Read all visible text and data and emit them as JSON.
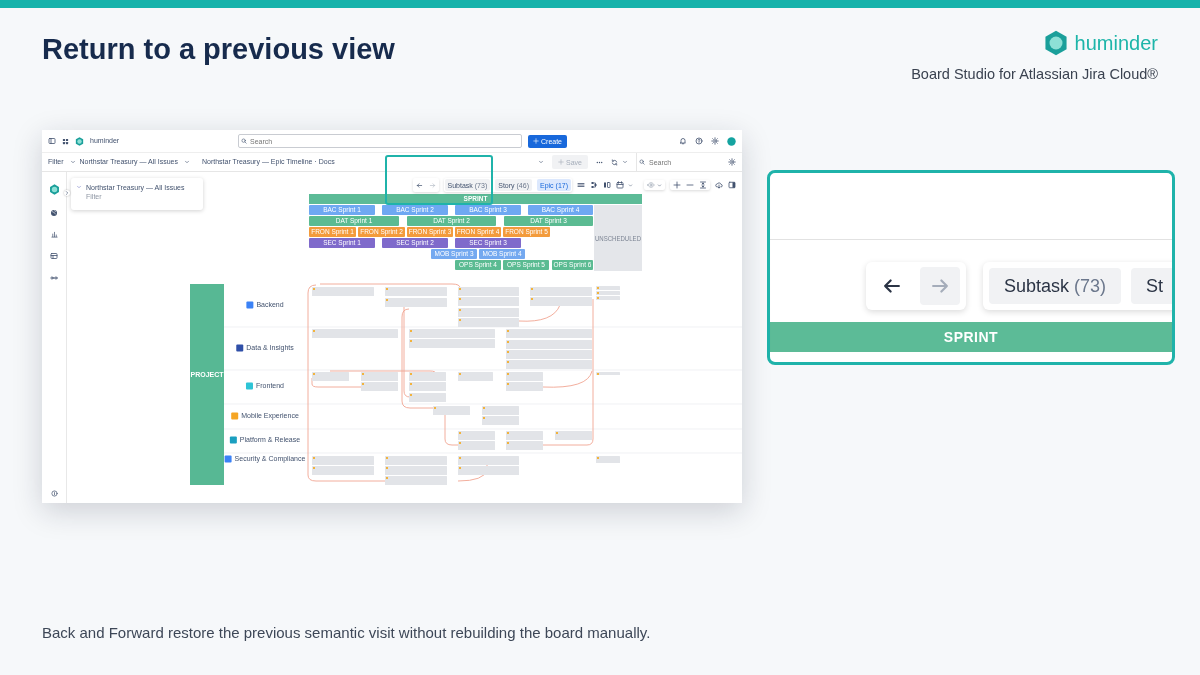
{
  "slide": {
    "title": "Return to a previous view",
    "brand": "huminder",
    "subtitle": "Board Studio for Atlassian Jira Cloud®",
    "caption": "Back and Forward restore the previous semantic visit without rebuilding the board manually."
  },
  "app": {
    "app_name": "huminder",
    "search": {
      "placeholder": "Search"
    },
    "create_label": "Create",
    "filter_bar": {
      "label": "Filter",
      "view": "Northstar Treasury — All Issues",
      "board": "Northstar Treasury — Epic Timeline · Docs",
      "save_label": "Save",
      "save_disabled": true,
      "search": {
        "placeholder": "Search"
      }
    },
    "filter_card": {
      "title": "Northstar Treasury — All Issues",
      "subtitle": "Filter"
    },
    "history": [
      {
        "kind": "back",
        "disabled": false
      },
      {
        "kind": "forward",
        "disabled": true
      }
    ],
    "type_chips": [
      {
        "label": "Subtask",
        "count": "(73)",
        "selected": false
      },
      {
        "label": "Story",
        "count": "(46)",
        "selected": false
      },
      {
        "label": "Epic",
        "count": "(17)",
        "selected": true
      }
    ],
    "timeline": {
      "header": "SPRINT",
      "unscheduled": "UNSCHEDULED",
      "rows": [
        {
          "sprints": [
            {
              "label": "BAC Sprint 1",
              "color": "#6ea8f2"
            },
            {
              "label": "BAC Sprint 2",
              "color": "#6ea8f2"
            },
            {
              "label": "BAC Sprint 3",
              "color": "#6ea8f2"
            },
            {
              "label": "BAC Sprint 4",
              "color": "#6ea8f2"
            }
          ]
        },
        {
          "sprints": [
            {
              "label": "DAT Sprint 1",
              "color": "#5bbb92"
            },
            {
              "label": "DAT Sprint 2",
              "color": "#5bbb92"
            },
            {
              "label": "DAT Sprint 3",
              "color": "#5bbb92"
            }
          ]
        },
        {
          "sprints": [
            {
              "label": "FRON Sprint 1",
              "color": "#f39b3c"
            },
            {
              "label": "FRON Sprint 2",
              "color": "#f39b3c"
            },
            {
              "label": "FRON Sprint 3",
              "color": "#f39b3c"
            },
            {
              "label": "FRON Sprint 4",
              "color": "#f39b3c"
            },
            {
              "label": "FRON Sprint 5",
              "color": "#f39b3c"
            }
          ]
        },
        {
          "sprints": [
            {
              "label": "SEC Sprint 1",
              "color": "#7f6acb"
            },
            {
              "label": "SEC Sprint 2",
              "color": "#7f6acb"
            },
            {
              "label": "SEC Sprint 3",
              "color": "#7f6acb"
            }
          ]
        },
        {
          "sprints": [
            {
              "label": "MOB Sprint 3",
              "color": "#74a9f0"
            },
            {
              "label": "MOB Sprint 4",
              "color": "#74a9f0"
            }
          ]
        },
        {
          "sprints": [
            {
              "label": "OPS Sprint 4",
              "color": "#5bbb92"
            },
            {
              "label": "OPS Sprint 5",
              "color": "#5bbb92"
            },
            {
              "label": "OPS Sprint 6",
              "color": "#5bbb92"
            }
          ]
        }
      ]
    },
    "lanes": {
      "header": "PROJECT",
      "items": [
        {
          "name": "Backend",
          "color": "#3b82f6"
        },
        {
          "name": "Data & Insights",
          "color": "#2f4fa8"
        },
        {
          "name": "Frontend",
          "color": "#2ec4d6"
        },
        {
          "name": "Mobile Experience",
          "color": "#f5a524"
        },
        {
          "name": "Platform & Release",
          "color": "#1a9fc0"
        },
        {
          "name": "Security & Compliance",
          "color": "#3b82f6"
        }
      ]
    }
  },
  "zoom": {
    "history": [
      {
        "kind": "back",
        "disabled": false
      },
      {
        "kind": "forward",
        "disabled": true
      }
    ],
    "chips": [
      {
        "label": "Subtask",
        "count": "(73)"
      },
      {
        "label": "St"
      }
    ],
    "header": "SPRINT"
  }
}
